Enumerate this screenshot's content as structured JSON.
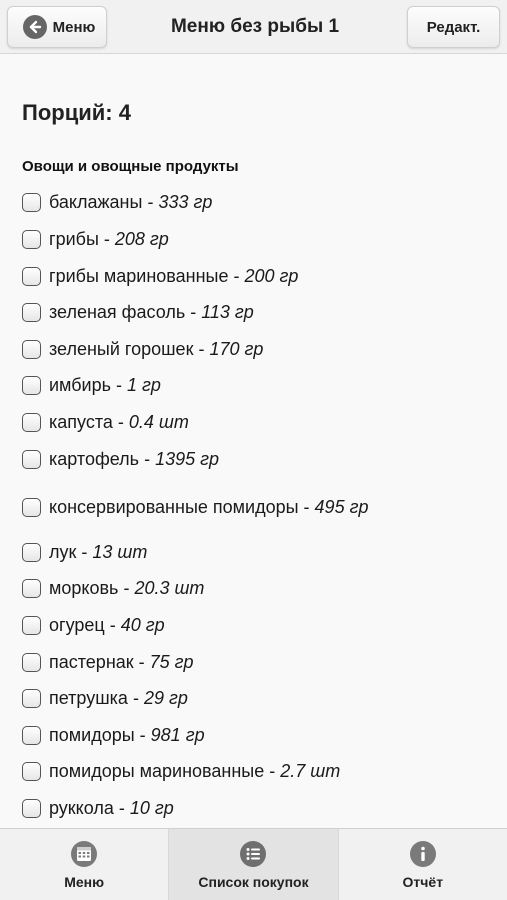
{
  "header": {
    "back_label": "Меню",
    "title": "Меню без рыбы 1",
    "edit_label": "Редакт."
  },
  "portions_label": "Порций: 4",
  "category": "Овощи и овощные продукты",
  "items": [
    {
      "name": "баклажаны",
      "qty": "333 гр"
    },
    {
      "name": "грибы",
      "qty": "208 гр"
    },
    {
      "name": "грибы маринованные",
      "qty": "200 гр"
    },
    {
      "name": "зеленая фасоль",
      "qty": "113 гр"
    },
    {
      "name": "зеленый горошек",
      "qty": "170 гр"
    },
    {
      "name": "имбирь",
      "qty": "1 гр"
    },
    {
      "name": "капуста",
      "qty": "0.4 шт"
    },
    {
      "name": "картофель",
      "qty": "1395 гр"
    },
    {
      "name": "консервированные помидоры",
      "qty": "495 гр"
    },
    {
      "name": "лук",
      "qty": "13 шт"
    },
    {
      "name": "морковь",
      "qty": "20.3 шт"
    },
    {
      "name": "огурец",
      "qty": "40 гр"
    },
    {
      "name": "пастернак",
      "qty": "75 гр"
    },
    {
      "name": "петрушка",
      "qty": "29 гр"
    },
    {
      "name": "помидоры",
      "qty": "981 гр"
    },
    {
      "name": "помидоры маринованные",
      "qty": "2.7 шт"
    },
    {
      "name": "руккола",
      "qty": "10 гр"
    }
  ],
  "tabs": [
    {
      "label": "Меню",
      "icon": "calendar-icon"
    },
    {
      "label": "Список покупок",
      "icon": "list-icon",
      "active": true
    },
    {
      "label": "Отчёт",
      "icon": "info-icon"
    }
  ]
}
